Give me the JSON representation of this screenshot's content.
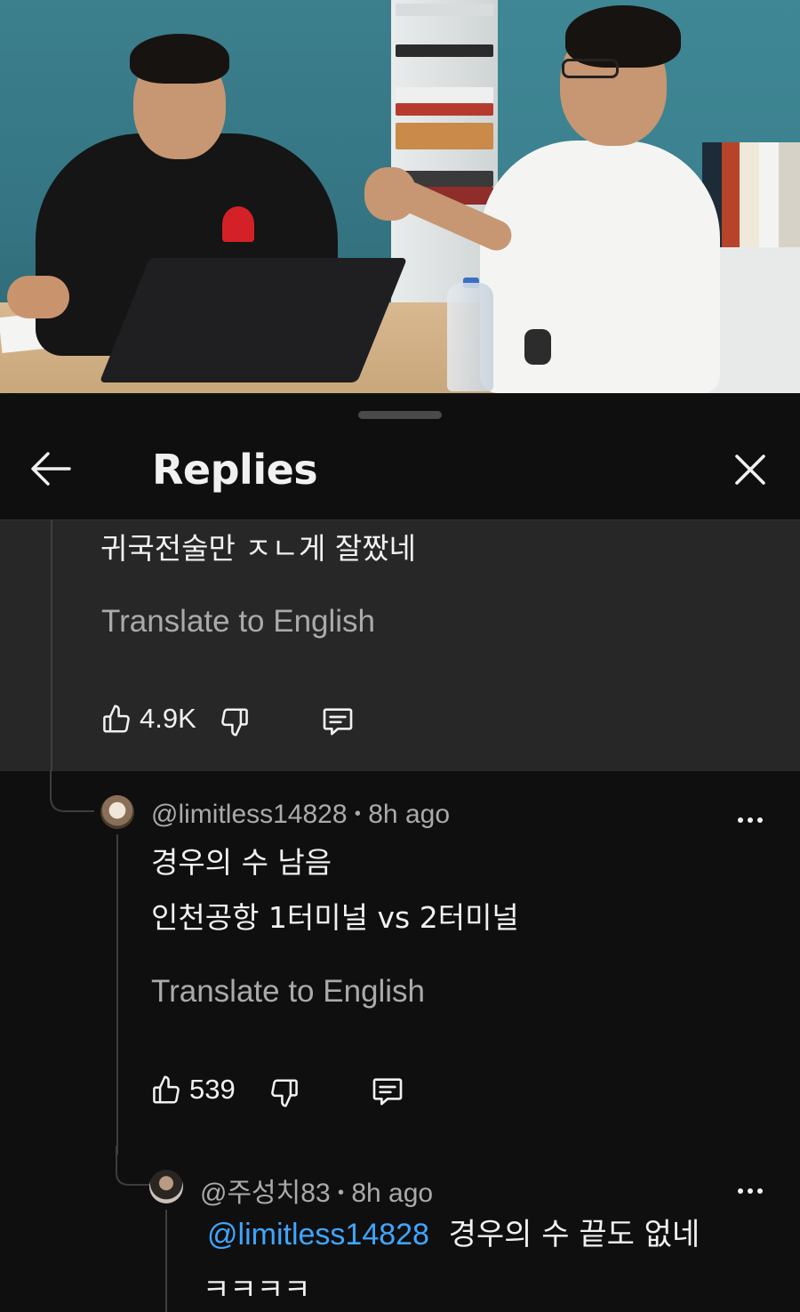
{
  "header": {
    "title": "Replies",
    "back_icon": "arrow-left-icon",
    "close_icon": "close-icon"
  },
  "parent_comment": {
    "text": "귀국전술만 ㅈㄴ게 잘짰네",
    "translate_label": "Translate to English",
    "like_count": "4.9K"
  },
  "replies": [
    {
      "handle": "@limitless14828",
      "separator": "•",
      "time": "8h ago",
      "lines": [
        "경우의 수 남음",
        "인천공항 1터미널 vs 2터미널"
      ],
      "translate_label": "Translate to English",
      "like_count": "539"
    },
    {
      "handle": "@주성치83",
      "separator": "•",
      "time": "8h ago",
      "mention": "@limitless14828",
      "text": "경우의 수 끝도 없네",
      "line2": "ㅋㅋㅋㅋ"
    }
  ],
  "colors": {
    "background": "#0f0f0f",
    "highlight": "#272727",
    "text": "#f1f1f1",
    "secondary": "#aaaaaa",
    "link": "#3ea6ff"
  }
}
